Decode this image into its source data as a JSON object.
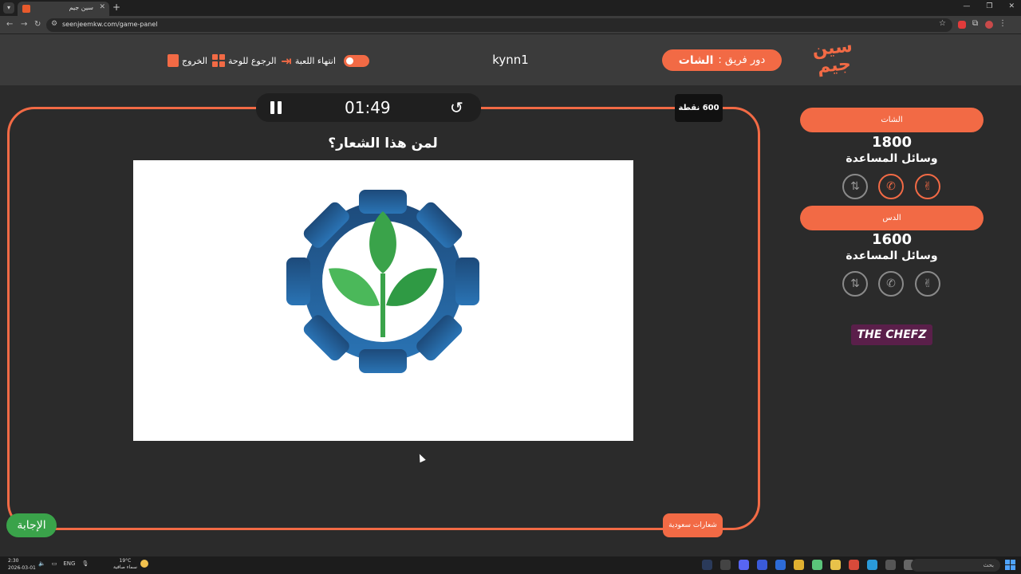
{
  "browser": {
    "tab_title": "سين جيم",
    "url": "seenjeemkw.com/game-panel"
  },
  "header": {
    "logo_text": "سين جيم",
    "turn_prefix": "دور فريق :",
    "turn_team": "الشات",
    "player_name": "kynn1",
    "end_game_label": "انتهاء اللعبة",
    "back_board_label": "الرجوع للوحة",
    "exit_label": "الخروج"
  },
  "game": {
    "timer": "01:49",
    "points_label": "600 نقطة",
    "question": "لمن هذا الشعار؟",
    "category_label": "شعارات سعودية",
    "answer_label": "الإجابة"
  },
  "teams": [
    {
      "name": "الشات",
      "score": "1800",
      "helpers_label": "وسائل المساعدة",
      "helpers_active": true
    },
    {
      "name": "الدس",
      "score": "1600",
      "helpers_label": "وسائل المساعدة",
      "helpers_active": false
    }
  ],
  "sponsor": {
    "text": "THE CHEFZ"
  },
  "taskbar": {
    "time": "2:30",
    "date": "2026-03-01",
    "lang": "ENG",
    "temp": "19°C",
    "weather": "سماء صافية",
    "search_placeholder": "بحث"
  },
  "colors": {
    "accent": "#f26a45",
    "answer": "#3aa34a",
    "logo_gear_top": "#1d4a7a",
    "logo_gear_bottom": "#2a74b5",
    "logo_leaf": "#3aa34a"
  }
}
